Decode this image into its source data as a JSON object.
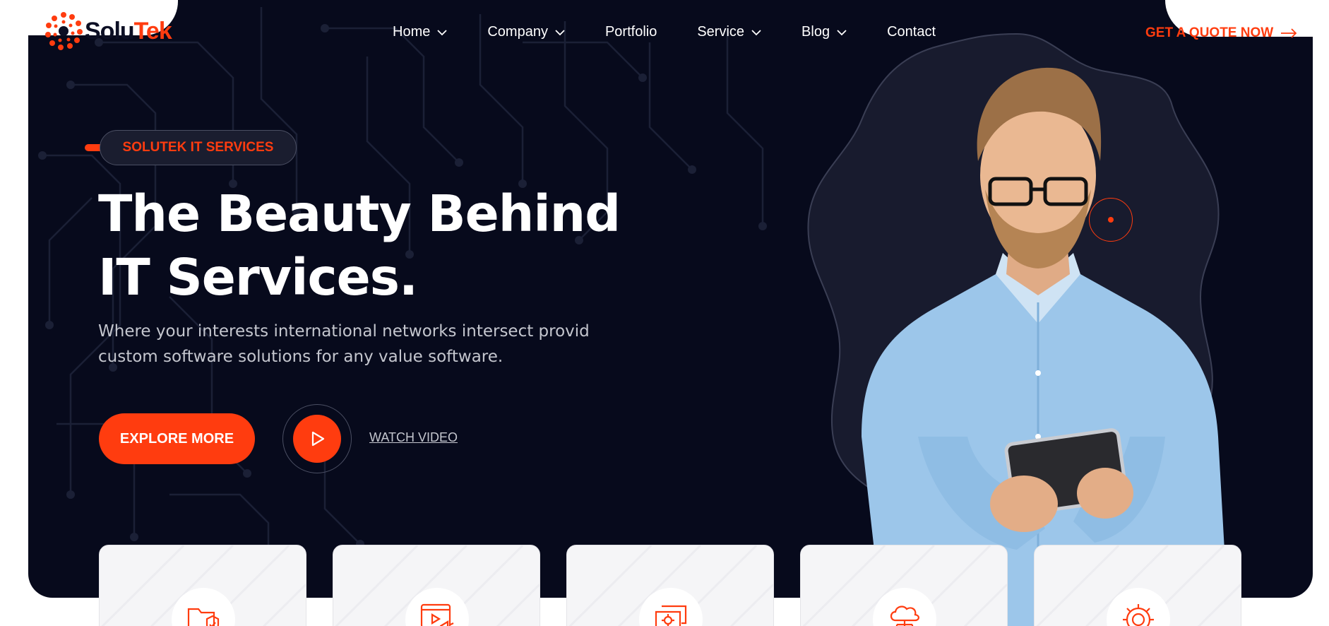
{
  "brand": {
    "name_part1": "Solu",
    "name_part2": "Tek"
  },
  "nav": {
    "items": [
      {
        "label": "Home",
        "has_dropdown": true
      },
      {
        "label": "Company",
        "has_dropdown": true
      },
      {
        "label": "Portfolio",
        "has_dropdown": false
      },
      {
        "label": "Service",
        "has_dropdown": true
      },
      {
        "label": "Blog",
        "has_dropdown": true
      },
      {
        "label": "Contact",
        "has_dropdown": false
      }
    ],
    "cta_label": "GET A QUOTE NOW"
  },
  "hero": {
    "tagline": "SOLUTEK IT SERVICES",
    "title_line1": "The Beauty Behind",
    "title_line2": "IT Services.",
    "subtitle_line1": "Where your interests international networks intersect provid",
    "subtitle_line2": "custom software solutions for any value software.",
    "primary_button": "EXPLORE MORE",
    "video_link": "WATCH VIDEO"
  },
  "service_cards": [
    {
      "icon": "folder-shield-icon"
    },
    {
      "icon": "video-megaphone-icon"
    },
    {
      "icon": "chat-gear-icon"
    },
    {
      "icon": "cloud-network-icon"
    },
    {
      "icon": "gear-icon"
    }
  ],
  "colors": {
    "accent": "#ff3c0f",
    "hero_background": "#070a1c",
    "text_light": "#ffffff",
    "text_muted": "#c4c6ce"
  }
}
